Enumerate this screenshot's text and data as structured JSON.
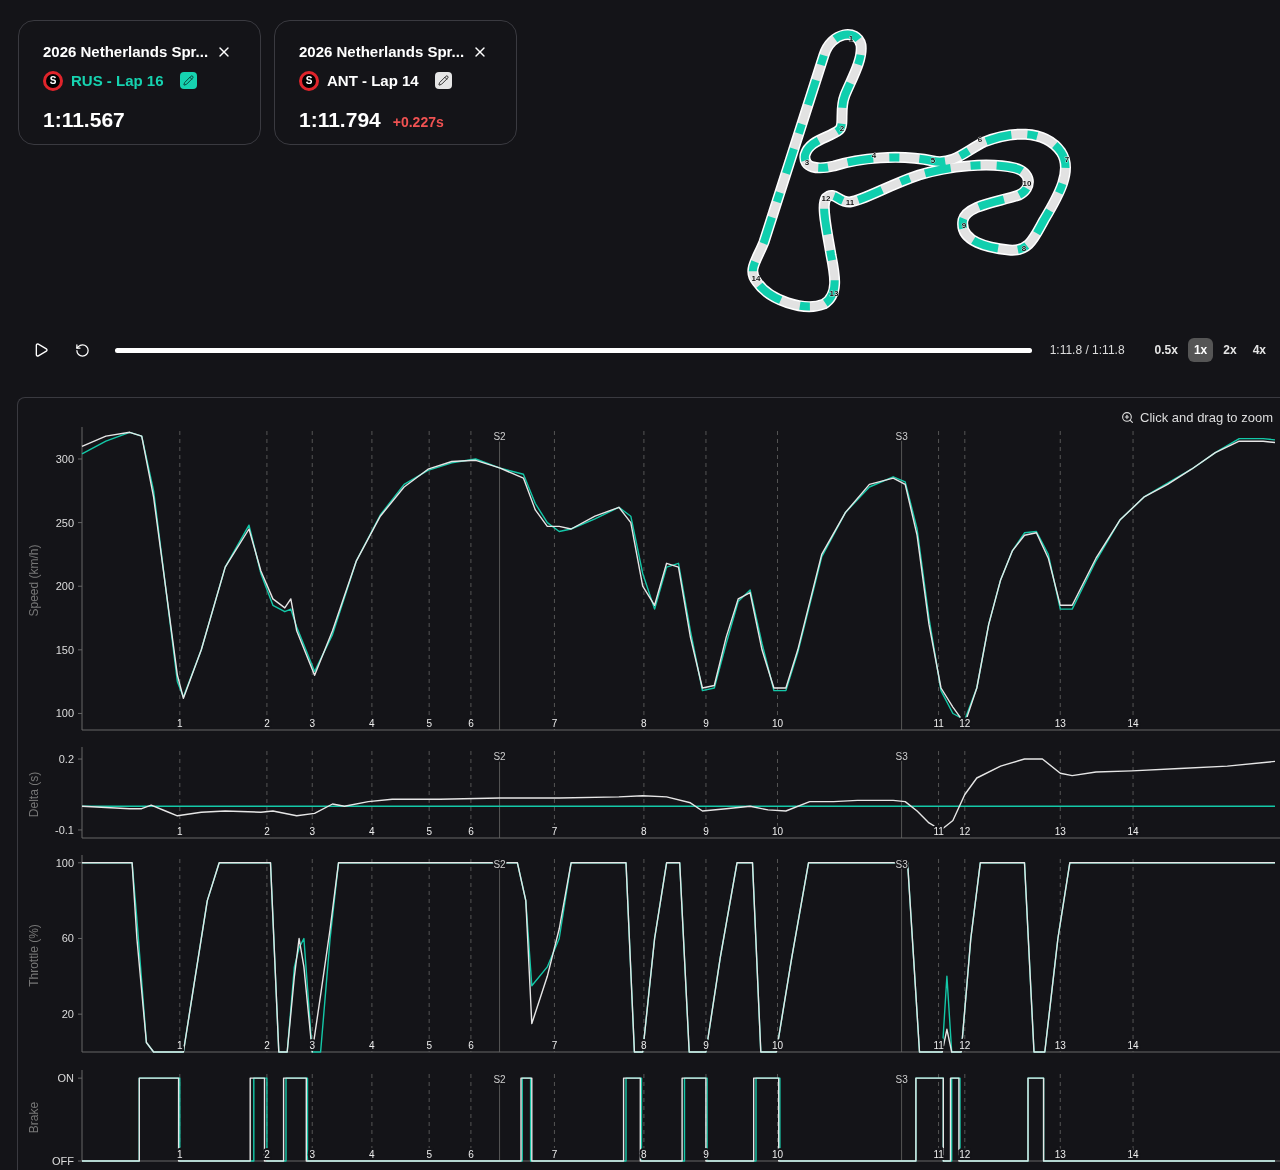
{
  "lap_cards": [
    {
      "title": "2026 Netherlands Spr...",
      "team_badge": "S",
      "lap_label": "RUS - Lap 16",
      "reference": true,
      "lap_time": "1:11.567"
    },
    {
      "title": "2026 Netherlands Spr...",
      "team_badge": "S",
      "lap_label": "ANT - Lap 14",
      "reference": false,
      "lap_time": "1:11.794",
      "gap": "+0.227s"
    }
  ],
  "track_map": {
    "corners": [
      "1",
      "2",
      "3",
      "4",
      "5",
      "6",
      "7",
      "8",
      "9",
      "10",
      "11",
      "12",
      "13",
      "14"
    ]
  },
  "playback": {
    "progress": {
      "level": 1
    },
    "time": "1:11.8 / 1:11.8",
    "speeds": [
      {
        "label": "0.5x",
        "selected": false
      },
      {
        "label": "1x",
        "selected": true
      },
      {
        "label": "2x",
        "selected": false
      },
      {
        "label": "4x",
        "selected": false
      }
    ]
  },
  "telemetry": {
    "zoom_hint": "Click and drag to zoom",
    "panels": [
      {
        "axis_title": "Speed (km/h)",
        "tick_labels": [
          "300",
          "250",
          "200",
          "150",
          "100"
        ],
        "corner_labels": [
          "1",
          "2",
          "3",
          "4",
          "5",
          "6",
          "7",
          "8",
          "9",
          "10",
          "11",
          "12",
          "13",
          "14"
        ],
        "sector_labels": [
          "S2",
          "S3"
        ]
      },
      {
        "axis_title": "Delta (s)",
        "tick_labels": [
          "0.2",
          "-0.1"
        ],
        "corner_labels": [
          "1",
          "2",
          "3",
          "4",
          "5",
          "6",
          "7",
          "8",
          "9",
          "10",
          "11",
          "12",
          "13",
          "14"
        ],
        "sector_labels": [
          "S2",
          "S3"
        ]
      },
      {
        "axis_title": "Throttle (%)",
        "tick_labels": [
          "100",
          "60",
          "20"
        ],
        "corner_labels": [
          "1",
          "2",
          "3",
          "4",
          "5",
          "6",
          "7",
          "8",
          "9",
          "10",
          "11",
          "12",
          "13",
          "14"
        ],
        "sector_labels": [
          "S2",
          "S3"
        ]
      },
      {
        "axis_title": "Brake",
        "tick_labels": [
          "ON",
          "OFF"
        ],
        "corner_labels": [
          "1",
          "2",
          "3",
          "4",
          "5",
          "6",
          "7",
          "8",
          "9",
          "10",
          "11",
          "12",
          "13",
          "14"
        ],
        "sector_labels": [
          "S2",
          "S3"
        ]
      }
    ]
  }
}
